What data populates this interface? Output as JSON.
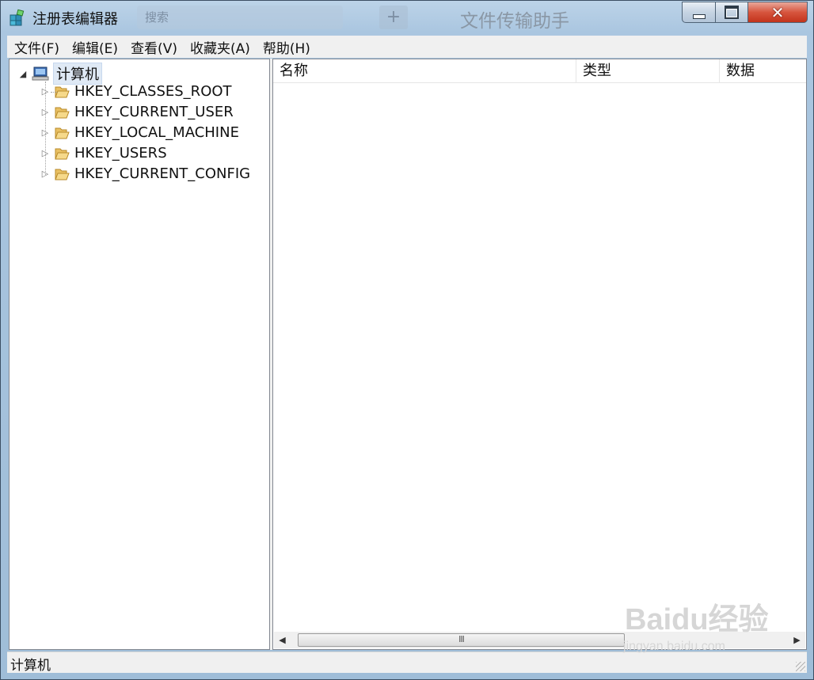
{
  "window": {
    "title": "注册表编辑器",
    "background_search_placeholder": "搜索",
    "background_plus": "+",
    "background_app_title": "文件传输助手"
  },
  "menu": [
    "文件(F)",
    "编辑(E)",
    "查看(V)",
    "收藏夹(A)",
    "帮助(H)"
  ],
  "tree": {
    "root": "计算机",
    "children": [
      "HKEY_CLASSES_ROOT",
      "HKEY_CURRENT_USER",
      "HKEY_LOCAL_MACHINE",
      "HKEY_USERS",
      "HKEY_CURRENT_CONFIG"
    ]
  },
  "list": {
    "columns": [
      "名称",
      "类型",
      "数据"
    ]
  },
  "scrollbar": {
    "thumb_grip": "III"
  },
  "status": {
    "path": "计算机"
  },
  "watermark": {
    "logo": "Baidu经验",
    "url": "jingyan.baidu.com"
  }
}
